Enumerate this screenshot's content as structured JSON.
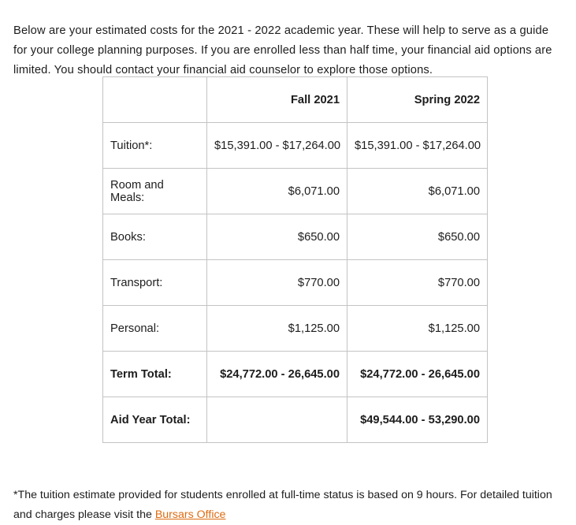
{
  "intro": {
    "paragraph": "Below are your estimated costs for the 2021 - 2022 academic year. These will help to serve as a guide for your college planning purposes. If you are enrolled less than half time, your financial aid options are limited. You should contact your financial aid counselor to explore those options."
  },
  "table": {
    "columns": [
      "",
      "Fall 2021",
      "Spring 2022"
    ],
    "corner_label": "",
    "rows": [
      {
        "label": "Tuition*:",
        "fall": "$15,391.00 - $17,264.00",
        "spring": "$15,391.00 - $17,264.00",
        "emphasis": false
      },
      {
        "label": "Room and Meals:",
        "fall": "$6,071.00",
        "spring": "$6,071.00",
        "emphasis": false
      },
      {
        "label": "Books:",
        "fall": "$650.00",
        "spring": "$650.00",
        "emphasis": false
      },
      {
        "label": "Transport:",
        "fall": "$770.00",
        "spring": "$770.00",
        "emphasis": false
      },
      {
        "label": "Personal:",
        "fall": "$1,125.00",
        "spring": "$1,125.00",
        "emphasis": false
      },
      {
        "label": "Term Total:",
        "fall": "$24,772.00 - 26,645.00",
        "spring": "$24,772.00 - 26,645.00",
        "emphasis": true
      },
      {
        "label": "Aid Year Total:",
        "fall": "",
        "spring": "$49,544.00 - 53,290.00",
        "emphasis": true
      }
    ]
  },
  "footnote": {
    "text_before_link": "*The tuition estimate provided for students enrolled at full-time status is based on 9 hours. For detailed tuition and charges please visit the ",
    "link_label": "Bursars Office",
    "text_after_link": ""
  },
  "colors": {
    "link": "#dd6b10",
    "text": "#1d1d1d",
    "table_border": "#c3c3c3",
    "background": "#ffffff"
  }
}
